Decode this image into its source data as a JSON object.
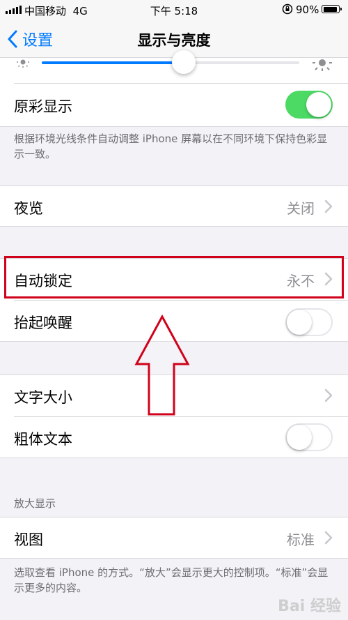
{
  "status_bar": {
    "carrier": "中国移动",
    "network": "4G",
    "time": "下午 5:18",
    "battery_percent": "90%"
  },
  "nav": {
    "back_label": "设置",
    "title": "显示与亮度"
  },
  "brightness": {
    "level": 0.55
  },
  "true_tone": {
    "label": "原彩显示",
    "enabled": true,
    "footer": "根据环境光线条件自动调整 iPhone 屏幕以在不同环境下保持色彩显示一致。"
  },
  "night_shift": {
    "label": "夜览",
    "value": "关闭"
  },
  "auto_lock": {
    "label": "自动锁定",
    "value": "永不"
  },
  "raise_to_wake": {
    "label": "抬起唤醒",
    "enabled": false
  },
  "text_size": {
    "label": "文字大小"
  },
  "bold_text": {
    "label": "粗体文本",
    "enabled": false
  },
  "zoom": {
    "header": "放大显示",
    "label": "视图",
    "value": "标准",
    "footer": "选取查看 iPhone 的方式。“放大”会显示更大的控制项。“标准”会显示更多的内容。"
  },
  "watermark": "Bai 经验",
  "colors": {
    "accent": "#007aff",
    "toggle_on": "#4cd964",
    "highlight": "#d0021b"
  }
}
